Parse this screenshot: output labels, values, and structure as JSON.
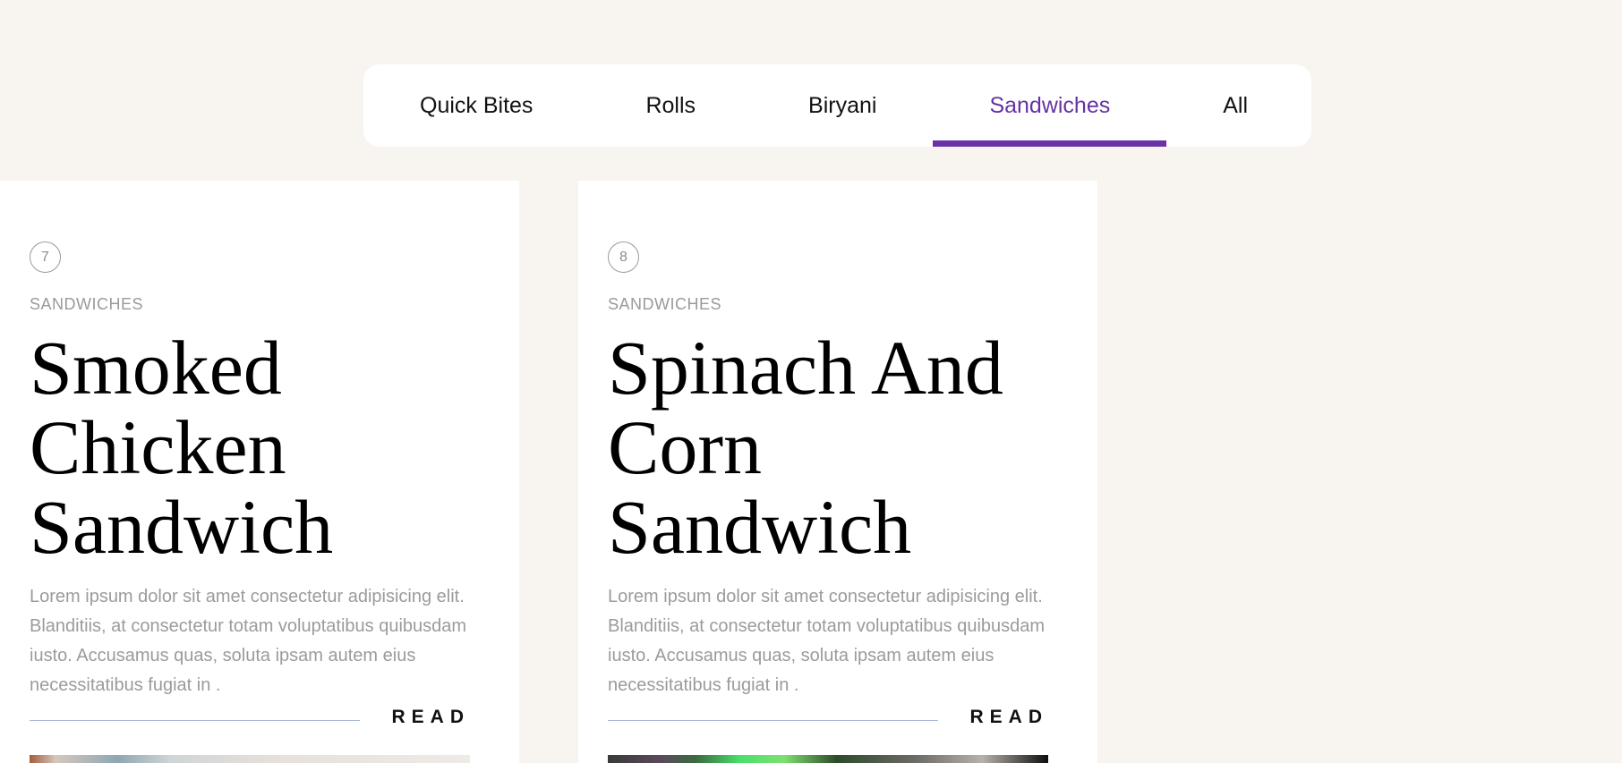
{
  "tabs": [
    {
      "label": "Quick Bites",
      "active": false
    },
    {
      "label": "Rolls",
      "active": false
    },
    {
      "label": "Biryani",
      "active": false
    },
    {
      "label": "Sandwiches",
      "active": true
    },
    {
      "label": "All",
      "active": false
    }
  ],
  "cards": [
    {
      "number": "7",
      "category": "SANDWICHES",
      "title": "Smoked Chicken Sandwich",
      "description": "Lorem ipsum dolor sit amet consectetur adipisicing elit. Blanditiis, at consectetur totam voluptatibus quibusdam iusto. Accusamus quas, soluta ipsam autem eius necessitatibus fugiat in .",
      "read_label": "READ"
    },
    {
      "number": "8",
      "category": "SANDWICHES",
      "title": "Spinach And Corn Sandwich",
      "description": "Lorem ipsum dolor sit amet consectetur adipisicing elit. Blanditiis, at consectetur totam voluptatibus quibusdam iusto. Accusamus quas, soluta ipsam autem eius necessitatibus fugiat in .",
      "read_label": "READ"
    }
  ],
  "colors": {
    "background": "#f8f5f1",
    "accent": "#6b32a8",
    "card": "#ffffff"
  }
}
